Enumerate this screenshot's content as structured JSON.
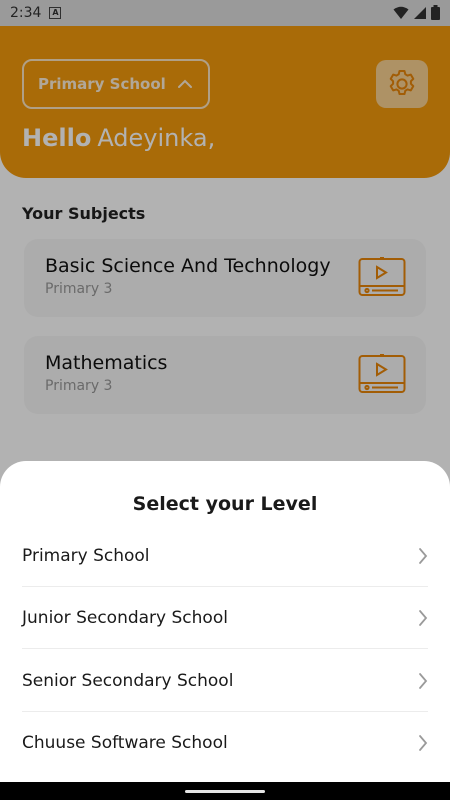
{
  "status_bar": {
    "time": "2:34",
    "notification_letter": "A"
  },
  "header": {
    "level_select_label": "Primary School",
    "greeting_bold": "Hello",
    "greeting_name": "Adeyinka,"
  },
  "subjects": {
    "title": "Your Subjects",
    "items": [
      {
        "name": "Basic Science And Technology",
        "level": "Primary 3"
      },
      {
        "name": "Mathematics",
        "level": "Primary 3"
      }
    ]
  },
  "level_sheet": {
    "title": "Select your Level",
    "options": [
      {
        "label": "Primary School"
      },
      {
        "label": "Junior Secondary School"
      },
      {
        "label": "Senior Secondary School"
      },
      {
        "label": "Chuuse Software School"
      }
    ]
  },
  "colors": {
    "brand_orange": "#F39A0C",
    "icon_orange": "#E8860A",
    "scrim": "rgba(0,0,0,0.30)"
  },
  "icons": {
    "settings": "gear-icon",
    "level_select": "chevron-up-icon",
    "subject": "video-lesson-icon",
    "option": "chevron-right-icon"
  }
}
